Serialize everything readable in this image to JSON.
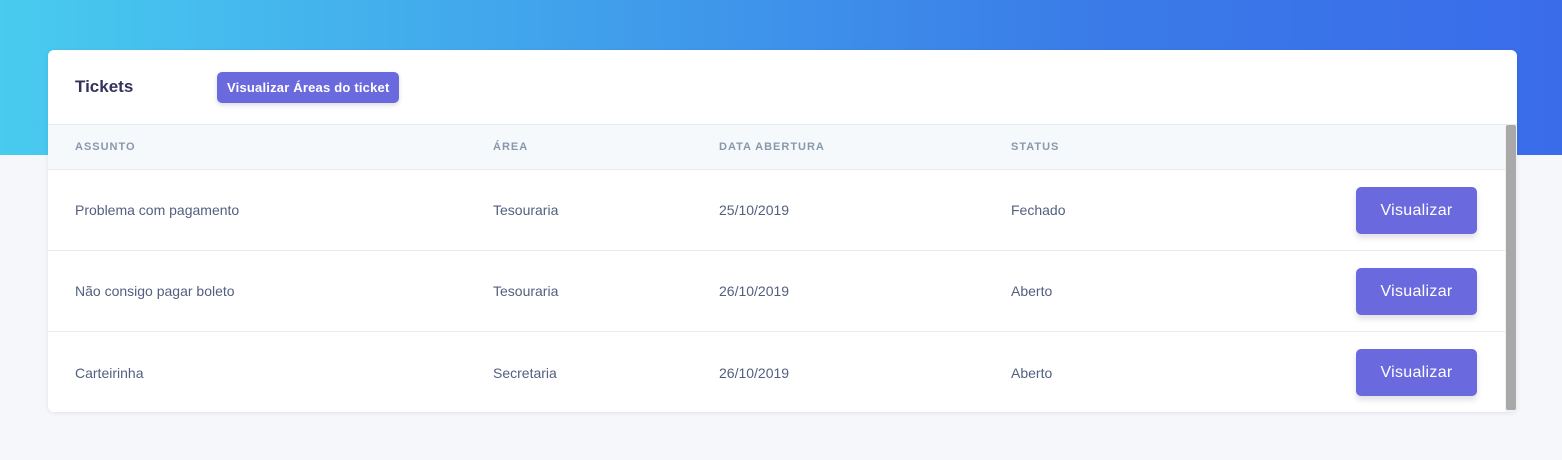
{
  "card": {
    "title": "Tickets",
    "header_button": "Visualizar Áreas do ticket"
  },
  "table": {
    "columns": [
      "ASSUNTO",
      "ÁREA",
      "DATA ABERTURA",
      "STATUS"
    ],
    "rows": [
      {
        "assunto": "Problema com pagamento",
        "area": "Tesouraria",
        "data": "25/10/2019",
        "status": "Fechado",
        "action": "Visualizar"
      },
      {
        "assunto": "Não consigo pagar boleto",
        "area": "Tesouraria",
        "data": "26/10/2019",
        "status": "Aberto",
        "action": "Visualizar"
      },
      {
        "assunto": "Carteirinha",
        "area": "Secretaria",
        "data": "26/10/2019",
        "status": "Aberto",
        "action": "Visualizar"
      }
    ]
  },
  "colors": {
    "accent": "#6b69de",
    "hero_start": "#48cbef",
    "hero_end": "#3a6cea"
  }
}
